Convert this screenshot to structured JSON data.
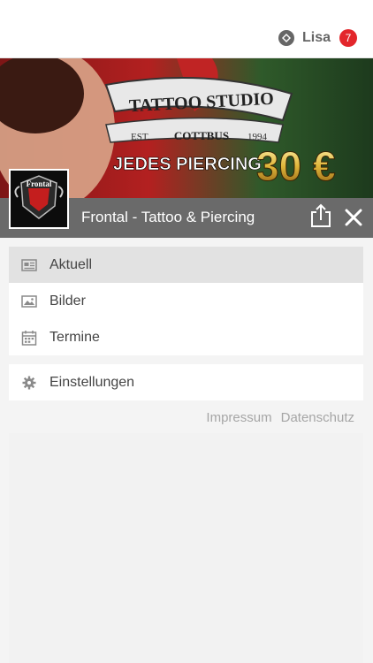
{
  "user": {
    "name": "Lisa",
    "notifications": "7"
  },
  "banner": {
    "studio_line": "TATTOO STUDIO",
    "est": "EST.",
    "city": "COTTBUS",
    "year": "1994",
    "promo": "JEDES PIERCING",
    "price": "30 €"
  },
  "page": {
    "title": "Frontal - Tattoo & Piercing"
  },
  "logo": {
    "text": "Frontal"
  },
  "menu": {
    "items": [
      {
        "label": "Aktuell",
        "icon": "newspaper-icon",
        "active": true
      },
      {
        "label": "Bilder",
        "icon": "image-icon",
        "active": false
      },
      {
        "label": "Termine",
        "icon": "calendar-icon",
        "active": false
      }
    ],
    "settings_label": "Einstellungen"
  },
  "footer": {
    "impressum": "Impressum",
    "datenschutz": "Datenschutz"
  },
  "colors": {
    "badge": "#e3262b",
    "title_bar": "#646464",
    "active_item": "#e2e2e2"
  }
}
